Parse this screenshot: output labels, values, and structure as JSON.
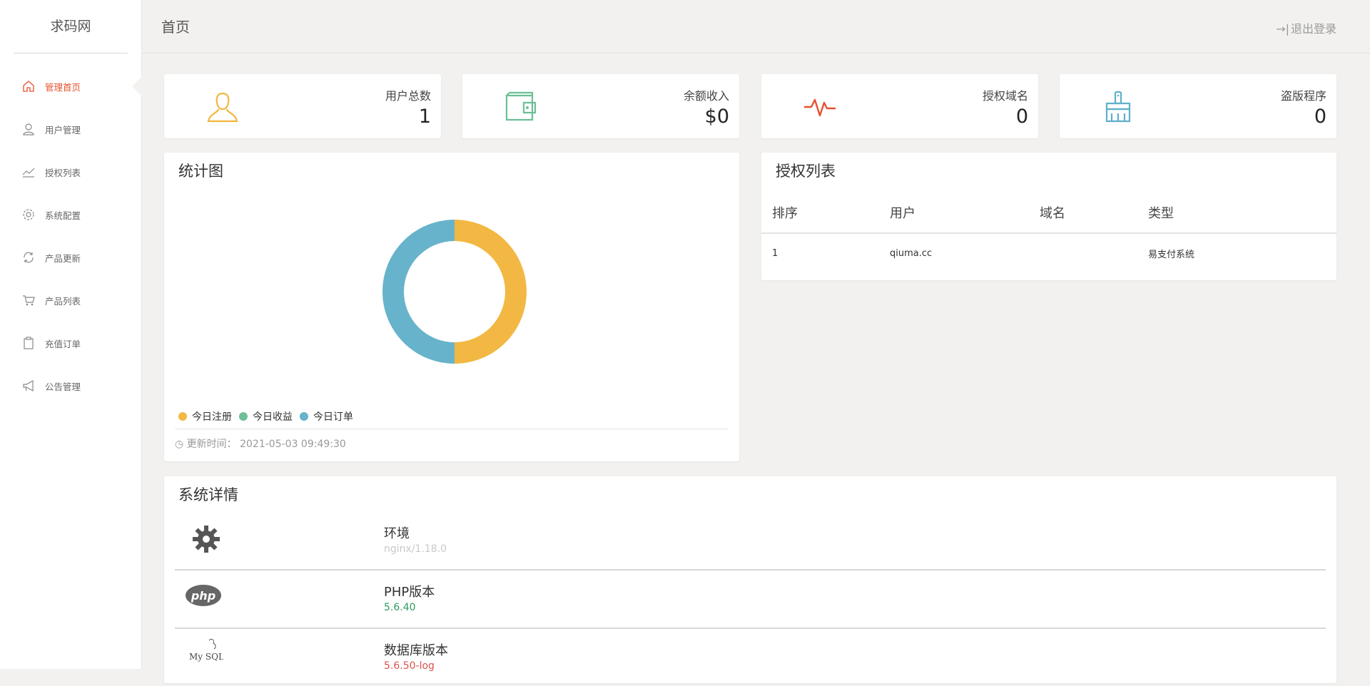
{
  "sidebar": {
    "brand": "求码网",
    "items": [
      {
        "label": "管理首页",
        "icon": "home-icon"
      },
      {
        "label": "用户管理",
        "icon": "user-icon"
      },
      {
        "label": "授权列表",
        "icon": "trend-icon"
      },
      {
        "label": "系统配置",
        "icon": "gear-icon"
      },
      {
        "label": "产品更新",
        "icon": "refresh-icon"
      },
      {
        "label": "产品列表",
        "icon": "cart-icon"
      },
      {
        "label": "充值订单",
        "icon": "clipboard-icon"
      },
      {
        "label": "公告管理",
        "icon": "megaphone-icon"
      }
    ]
  },
  "header": {
    "title": "首页",
    "logout": "退出登录"
  },
  "stats": [
    {
      "label": "用户总数",
      "value": "1",
      "icon": "user-icon",
      "color": "#f0b73f"
    },
    {
      "label": "余额收入",
      "value": "$0",
      "icon": "wallet-icon",
      "color": "#6bbf95"
    },
    {
      "label": "授权域名",
      "value": "0",
      "icon": "pulse-icon",
      "color": "#e6512e"
    },
    {
      "label": "盗版程序",
      "value": "0",
      "icon": "broom-icon",
      "color": "#5fb0cb"
    }
  ],
  "chart_panel": {
    "title": "统计图",
    "update_label": "更新时间：",
    "update_time": "2021-05-03 09:49:30"
  },
  "chart_data": {
    "type": "pie",
    "donut": true,
    "labels": [
      "今日注册",
      "今日收益",
      "今日订单"
    ],
    "values": [
      1,
      0,
      1
    ],
    "colors": [
      "#f2b843",
      "#6fbe98",
      "#67b3cb"
    ],
    "legend": "bottom-left"
  },
  "auth_list": {
    "title": "授权列表",
    "columns": [
      "排序",
      "用户",
      "域名",
      "类型"
    ],
    "rows": [
      [
        "1",
        "qiuma.cc",
        "",
        "易支付系统"
      ]
    ]
  },
  "system": {
    "title": "系统详情",
    "items": [
      {
        "name": "环境",
        "value": "nginx/1.18.0",
        "icon": "gear-icon",
        "color": "#c8c8c8"
      },
      {
        "name": "PHP版本",
        "value": "5.6.40",
        "icon": "php-logo-icon",
        "color": "#2e9c5e"
      },
      {
        "name": "数据库版本",
        "value": "5.6.50-log",
        "icon": "mysql-logo-icon",
        "color": "#d9534f"
      }
    ]
  }
}
